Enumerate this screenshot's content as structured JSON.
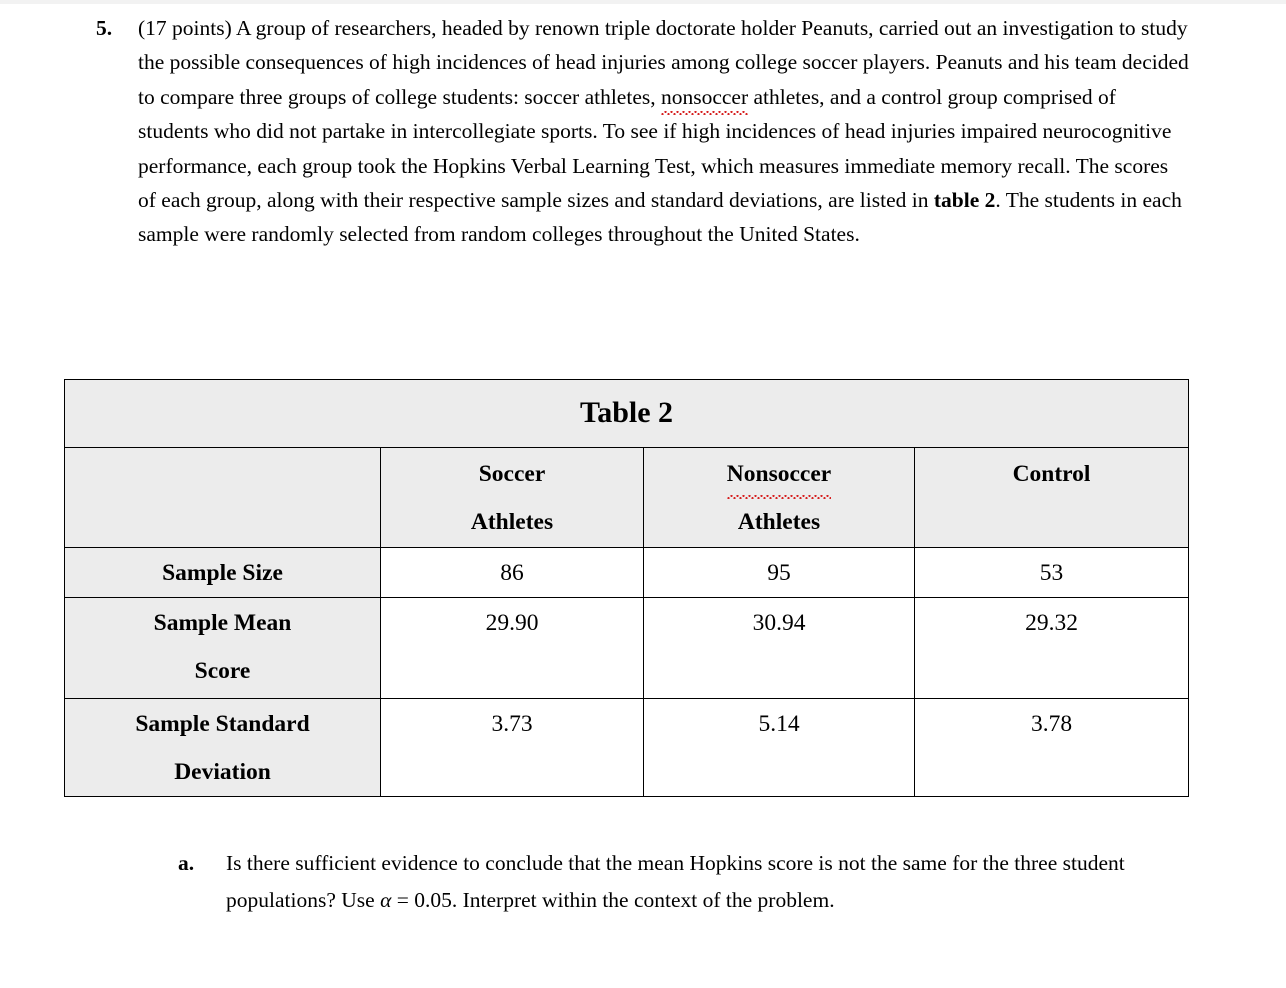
{
  "document": {
    "question": {
      "number": "5.",
      "points_prefix": "(17 points)",
      "body_part1": "(17 points) A group of researchers, headed by renown triple doctorate holder Peanuts, carried out an investigation to study the possible consequences of high incidences of head injuries among college soccer players. Peanuts and his team decided to compare three groups of college students: soccer athletes, ",
      "misspelled_word": "nonsoccer",
      "body_part2": " athletes, and a control group comprised of students who did not partake in intercollegiate sports. To see if high incidences of head injuries impaired neurocognitive performance, each group took the Hopkins Verbal Learning Test, which measures immediate memory recall.  The scores of each group, along with their respective sample sizes and standard deviations, are listed in ",
      "table_ref_bold": "table 2",
      "body_part3": ".  The students in each sample were randomly selected from random colleges throughout the United States."
    },
    "table": {
      "title": "Table 2",
      "corner_label": "",
      "column_headers": [
        {
          "line1": "Soccer",
          "line2": "Athletes",
          "misspelled": false
        },
        {
          "line1": "Nonsoccer",
          "line2": "Athletes",
          "misspelled": true
        },
        {
          "line1": "Control",
          "line2": "",
          "misspelled": false
        }
      ],
      "rows": [
        {
          "label_line1": "Sample Size",
          "label_line2": "",
          "values": [
            "86",
            "95",
            "53"
          ]
        },
        {
          "label_line1": "Sample Mean",
          "label_line2": "Score",
          "values": [
            "29.90",
            "30.94",
            "29.32"
          ]
        },
        {
          "label_line1": "Sample Standard",
          "label_line2": "Deviation",
          "values": [
            "3.73",
            "5.14",
            "3.78"
          ]
        }
      ]
    },
    "part_a": {
      "letter": "a.",
      "text_before_alpha": "Is there sufficient evidence to conclude that the mean Hopkins score is not the same for the three student populations? Use ",
      "alpha_symbol": "α",
      "text_after_alpha": " = 0.05. Interpret within the context of the problem."
    },
    "colors": {
      "header_fill": "#ececec",
      "cell_fill": "#ffffff",
      "border": "#000000",
      "spellcheck_underline": "#d62020",
      "text": "#000000"
    }
  }
}
